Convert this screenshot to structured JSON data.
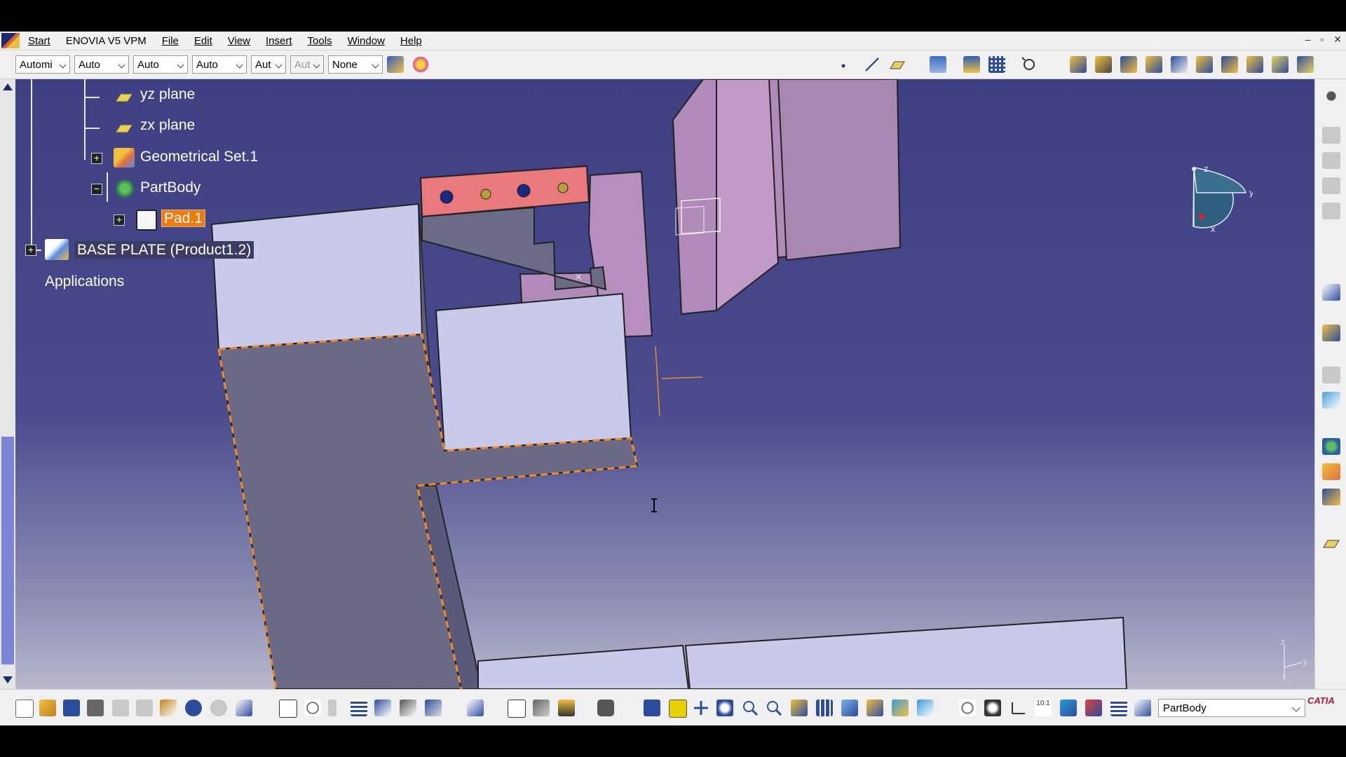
{
  "menubar": {
    "items": [
      "Start",
      "ENOVIA V5 VPM",
      "File",
      "Edit",
      "View",
      "Insert",
      "Tools",
      "Window",
      "Help"
    ],
    "window_controls": [
      "–",
      "▫",
      "✕"
    ]
  },
  "toolbar": {
    "combos": [
      "Automi",
      "Auto",
      "Auto",
      "Auto",
      "Aut",
      "Aut",
      "None"
    ]
  },
  "tree": {
    "items": [
      "yz plane",
      "zx plane",
      "Geometrical Set.1",
      "PartBody",
      "Pad.1",
      "BASE PLATE (Product1.2)",
      "Applications"
    ]
  },
  "compass": {
    "x": "x",
    "y": "y",
    "z": "z"
  },
  "axis_indicator": {
    "x": "x",
    "y": "y",
    "z": "z"
  },
  "bottombar": {
    "current_body": "PartBody",
    "logo": "CATIA"
  },
  "colors": {
    "viewport_top": "#3f3f84",
    "selection": "#f27a0f",
    "part_light": "#c9c9ea",
    "part_dark": "#6a6a86",
    "part_pink": "#b08ab8",
    "part_red": "#e9797a"
  }
}
